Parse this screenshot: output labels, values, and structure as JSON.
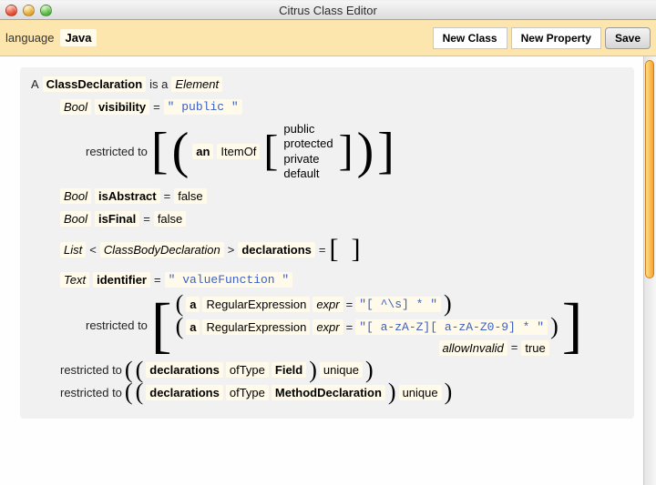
{
  "window": {
    "title": "Citrus Class Editor"
  },
  "toolbar": {
    "language_label": "language",
    "language_value": "Java",
    "new_class": "New Class",
    "new_property": "New Property",
    "save": "Save"
  },
  "decl": {
    "a": "A",
    "classdecl": "ClassDeclaration",
    "isa": "is a",
    "element": "Element"
  },
  "types": {
    "bool": "Bool",
    "list": "List",
    "text": "Text"
  },
  "kw": {
    "restricted_to": "restricted to",
    "an": "an",
    "a": "a",
    "ItemOf": "ItemOf",
    "ofType": "ofType",
    "unique": "unique",
    "RegularExpression": "RegularExpression",
    "expr": "expr",
    "allowInvalid": "allowInvalid",
    "eq": "=",
    "lt": "<",
    "gt": ">",
    "lp": "(",
    "rp": ")"
  },
  "props": {
    "visibility": {
      "name": "visibility",
      "val": "\" public \"",
      "options": [
        "public",
        "protected",
        "private",
        "default"
      ]
    },
    "isAbstract": {
      "name": "isAbstract",
      "val": "false"
    },
    "isFinal": {
      "name": "isFinal",
      "val": "false"
    },
    "declarations": {
      "name": "declarations",
      "param": "ClassBodyDeclaration"
    },
    "identifier": {
      "name": "identifier",
      "val": "\" valueFunction \"",
      "regex1": "\"[ ^\\s] * \"",
      "regex2": "\"[ a-zA-Z][ a-zA-Z0-9] * \"",
      "allowInvalid": "true"
    }
  },
  "constraints": {
    "c1_ref": "declarations",
    "c1_type": "Field",
    "c2_ref": "declarations",
    "c2_type": "MethodDeclaration"
  }
}
